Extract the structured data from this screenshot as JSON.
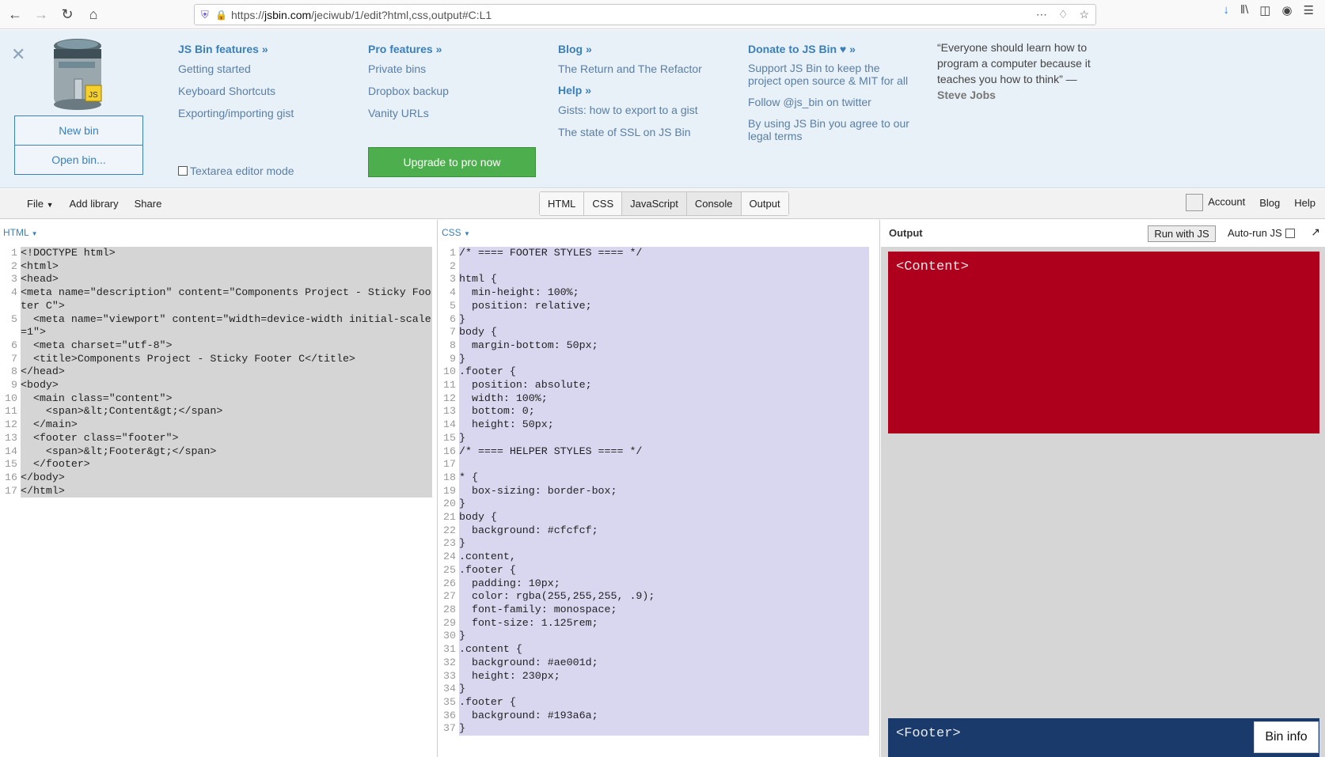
{
  "browser": {
    "url_prefix": "https://",
    "url_domain": "jsbin.com",
    "url_path": "/jeciwub/1/edit?html,css,output#C:L1"
  },
  "infocard": {
    "new_bin": "New bin",
    "open_bin": "Open bin...",
    "textarea_mode": "Textarea editor mode",
    "upgrade": "Upgrade to pro now",
    "col1": {
      "title": "JS Bin features »",
      "links": [
        "Getting started",
        "Keyboard Shortcuts",
        "Exporting/importing gist"
      ]
    },
    "col2": {
      "title": "Pro features »",
      "links": [
        "Private bins",
        "Dropbox backup",
        "Vanity URLs"
      ]
    },
    "col3": {
      "title": "Blog »",
      "links": [
        "The Return and The Refactor"
      ],
      "title2": "Help »",
      "links2": [
        "Gists: how to export to a gist",
        "The state of SSL on JS Bin"
      ]
    },
    "col4": {
      "title": "Donate to JS Bin ♥ »",
      "links": [
        "Support JS Bin to keep the project open source & MIT for all",
        "Follow @js_bin on twitter",
        "By using JS Bin you agree to our legal terms"
      ]
    },
    "quote": "“Everyone should learn how to program a computer because it teaches you how to think” —",
    "quote_author": "Steve Jobs"
  },
  "toolbar": {
    "file": "File",
    "add_library": "Add library",
    "share": "Share",
    "tabs": [
      "HTML",
      "CSS",
      "JavaScript",
      "Console",
      "Output"
    ],
    "account": "Account",
    "blog": "Blog",
    "help": "Help"
  },
  "html_panel": {
    "label": "HTML",
    "lines": [
      "<!DOCTYPE html>",
      "<html>",
      "<head>",
      "<meta name=\"description\" content=\"Components Project - Sticky Footer C\">",
      "  <meta name=\"viewport\" content=\"width=device-width initial-scale=1\">",
      "  <meta charset=\"utf-8\">",
      "  <title>Components Project - Sticky Footer C</title>",
      "</head>",
      "<body>",
      "  <main class=\"content\">",
      "    <span>&lt;Content&gt;</span>",
      "  </main>",
      "  <footer class=\"footer\">",
      "    <span>&lt;Footer&gt;</span>",
      "  </footer>",
      "</body>",
      "</html>"
    ]
  },
  "css_panel": {
    "label": "CSS",
    "lines": [
      "/* ==== FOOTER STYLES ==== */",
      "",
      "html {",
      "  min-height: 100%;",
      "  position: relative;",
      "}",
      "body {",
      "  margin-bottom: 50px;",
      "}",
      ".footer {",
      "  position: absolute;",
      "  width: 100%;",
      "  bottom: 0;",
      "  height: 50px;",
      "}",
      "/* ==== HELPER STYLES ==== */",
      "",
      "* {",
      "  box-sizing: border-box;",
      "}",
      "body {",
      "  background: #cfcfcf;",
      "}",
      ".content,",
      ".footer {",
      "  padding: 10px;",
      "  color: rgba(255,255,255, .9);",
      "  font-family: monospace;",
      "  font-size: 1.125rem;",
      "}",
      ".content {",
      "  background: #ae001d;",
      "  height: 230px;",
      "}",
      ".footer {",
      "  background: #193a6a;",
      "}"
    ]
  },
  "output_panel": {
    "label": "Output",
    "run_btn": "Run with JS",
    "autorun": "Auto-run JS",
    "content_text": "<Content>",
    "footer_text": "<Footer>",
    "bin_info": "Bin info"
  }
}
